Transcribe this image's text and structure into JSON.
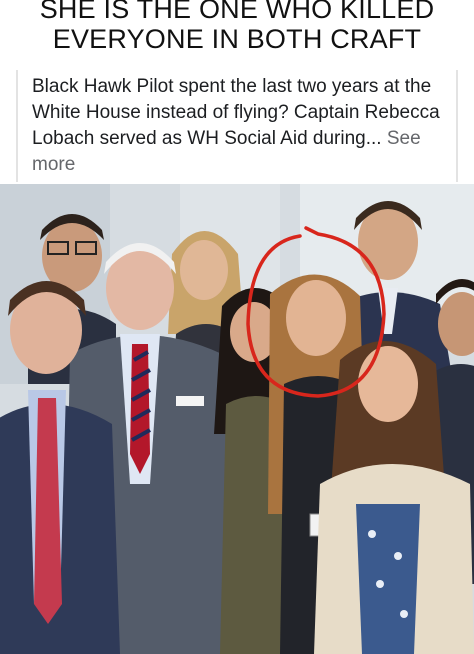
{
  "caption": {
    "line1": "SHE IS THE ONE WHO KILLED",
    "line2": "EVERYONE IN BOTH CRAFT"
  },
  "post": {
    "text": "Black Hawk Pilot spent the last two years at the White House instead of flying?  Captain Rebecca Lobach served as WH Social Aid during...",
    "see_more": " See more"
  },
  "photo": {
    "highlight_color": "#d8261c"
  }
}
